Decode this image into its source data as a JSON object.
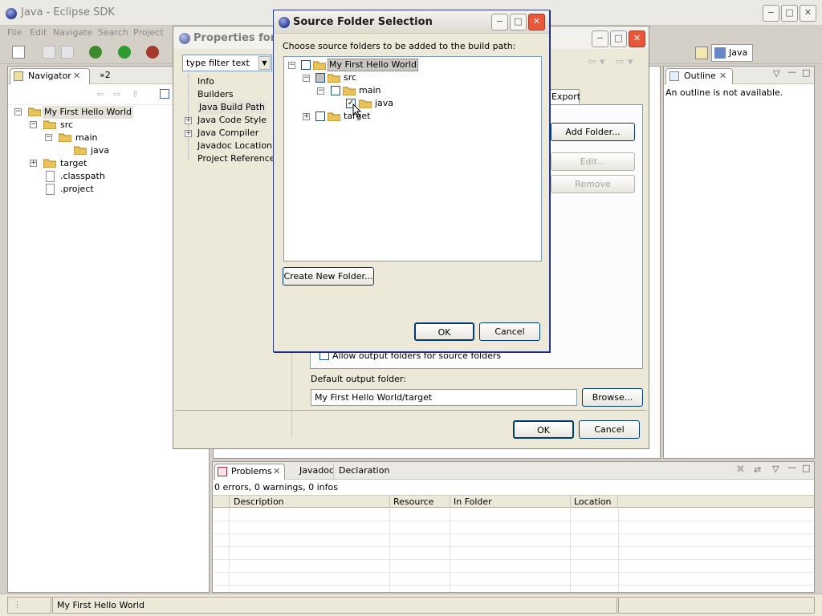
{
  "main_window": {
    "title": "Java - Eclipse SDK",
    "controls": {
      "minimize": "−",
      "maximize": "□",
      "close": "✕"
    }
  },
  "menubar": [
    "File",
    "Edit",
    "Navigate",
    "Search",
    "Project"
  ],
  "toolbar": {
    "perspective_label": "Java"
  },
  "navigator": {
    "tab_label": "Navigator",
    "overflow_tab": "»2",
    "tree": [
      {
        "label": "My First Hello World",
        "level": 0,
        "expanded": true,
        "type": "project"
      },
      {
        "label": "src",
        "level": 1,
        "expanded": true,
        "type": "folder"
      },
      {
        "label": "main",
        "level": 2,
        "expanded": true,
        "type": "folder"
      },
      {
        "label": "java",
        "level": 3,
        "type": "folder"
      },
      {
        "label": "target",
        "level": 1,
        "expanded": false,
        "type": "folder"
      },
      {
        "label": ".classpath",
        "level": 1,
        "type": "file"
      },
      {
        "label": ".project",
        "level": 1,
        "type": "file"
      }
    ]
  },
  "outline": {
    "tab_label": "Outline",
    "message": "An outline is not available."
  },
  "bottom_panel": {
    "tabs": [
      "Problems",
      "Javadoc",
      "Declaration"
    ],
    "summary": "0 errors, 0 warnings, 0 infos",
    "columns": [
      "Description",
      "Resource",
      "In Folder",
      "Location"
    ]
  },
  "status_bar": {
    "text": "My First Hello World"
  },
  "properties_dialog": {
    "title": "Properties for M",
    "filter_placeholder": "type filter text",
    "nav_items": [
      {
        "label": "Info",
        "expandable": false
      },
      {
        "label": "Builders",
        "expandable": false
      },
      {
        "label": "Java Build Path",
        "expandable": false,
        "selected": true
      },
      {
        "label": "Java Code Style",
        "expandable": true
      },
      {
        "label": "Java Compiler",
        "expandable": true
      },
      {
        "label": "Javadoc Location",
        "expandable": false
      },
      {
        "label": "Project References",
        "expandable": false
      }
    ],
    "visible_tab_fragment": "Export",
    "buttons": {
      "add_folder": "Add Folder...",
      "edit": "Edit...",
      "remove": "Remove",
      "browse": "Browse...",
      "ok": "OK",
      "cancel": "Cancel"
    },
    "allow_output_label": "Allow output folders for source folders",
    "default_output_label": "Default output folder:",
    "default_output_value": "My First Hello World/target"
  },
  "source_folder_dialog": {
    "title": "Source Folder Selection",
    "instruction": "Choose source folders to be added to the build path:",
    "tree": [
      {
        "label": "My First Hello World",
        "level": 0,
        "toggle": "−",
        "checked": false,
        "gray": false,
        "selected": true
      },
      {
        "label": "src",
        "level": 1,
        "toggle": "−",
        "checked": false,
        "gray": true
      },
      {
        "label": "main",
        "level": 2,
        "toggle": "−",
        "checked": false,
        "gray": false
      },
      {
        "label": "java",
        "level": 3,
        "toggle": "",
        "checked": true,
        "gray": false
      },
      {
        "label": "target",
        "level": 1,
        "toggle": "+",
        "checked": false,
        "gray": false
      }
    ],
    "buttons": {
      "create_new_folder": "Create New Folder...",
      "ok": "OK",
      "cancel": "Cancel"
    }
  }
}
